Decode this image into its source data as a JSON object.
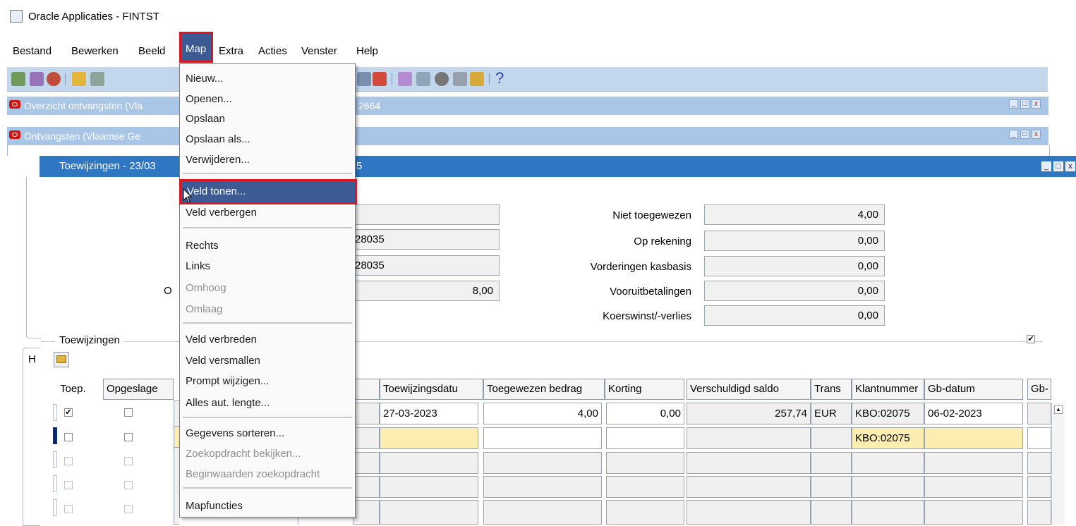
{
  "window": {
    "title": "Oracle Applicaties - FINTST"
  },
  "menubar": {
    "items": [
      {
        "label": "Bestand"
      },
      {
        "label": "Bewerken"
      },
      {
        "label": "Beeld"
      },
      {
        "label": "Map"
      },
      {
        "label": "Extra"
      },
      {
        "label": "Acties"
      },
      {
        "label": "Venster"
      },
      {
        "label": "Help"
      }
    ]
  },
  "toolbar": {
    "help_glyph": "?"
  },
  "windows": {
    "overzicht_title": "Overzicht ontvangsten (Vla",
    "overzicht_title_tail": "2664",
    "ontvangsten_title": "Ontvangsten (Vlaamse Ge",
    "toewijzingen_title": "Toewijzingen - 23/03",
    "toewijzingen_title_tail": "5"
  },
  "summary": {
    "left_values": [
      "28035",
      "28035",
      "8,00"
    ],
    "left_partial_label": "O",
    "right_labels": [
      "Niet toegewezen",
      "Op rekening",
      "Vorderingen kasbasis",
      "Vooruitbetalingen",
      "Koerswinst/-verlies"
    ],
    "right_values": [
      "4,00",
      "0,00",
      "0,00",
      "0,00",
      "0,00"
    ]
  },
  "section": {
    "label": "Toewijzingen",
    "tab_partial": "H",
    "checkbox_checked": "✔"
  },
  "table": {
    "headers": {
      "toep": "Toep.",
      "opgeslagen": "Opgeslage",
      "toewijzingsdatum": "Toewijzingsdatu",
      "toegewezen_bedrag": "Toegewezen bedrag",
      "korting": "Korting",
      "verschuldigd_saldo": "Verschuldigd saldo",
      "trans": "Trans",
      "klantnummer": "Klantnummer",
      "gb_datum": "Gb-datum",
      "gb2": "Gb-"
    },
    "row1": {
      "toep": "✔",
      "toewijzingsdatum": "27-03-2023",
      "toegewezen_bedrag": "4,00",
      "korting": "0,00",
      "verschuldigd_saldo": "257,74",
      "trans": "EUR",
      "klantnummer": "KBO:02075",
      "gb_datum": "06-02-2023"
    },
    "row2": {
      "klantnummer": "KBO:02075"
    }
  },
  "dropdown": {
    "items": [
      {
        "label": "Nieuw...",
        "enabled": true
      },
      {
        "label": "Openen...",
        "enabled": true
      },
      {
        "label": "Opslaan",
        "enabled": true
      },
      {
        "label": "Opslaan als...",
        "enabled": true
      },
      {
        "label": "Verwijderen...",
        "enabled": true
      },
      {
        "label": "Veld tonen...",
        "enabled": true,
        "highlighted": true
      },
      {
        "label": "Veld verbergen",
        "enabled": true
      },
      {
        "label": "Rechts",
        "enabled": true
      },
      {
        "label": "Links",
        "enabled": true
      },
      {
        "label": "Omhoog",
        "enabled": false
      },
      {
        "label": "Omlaag",
        "enabled": false
      },
      {
        "label": "Veld verbreden",
        "enabled": true
      },
      {
        "label": "Veld versmallen",
        "enabled": true
      },
      {
        "label": "Prompt wijzigen...",
        "enabled": true
      },
      {
        "label": "Alles aut. lengte...",
        "enabled": true
      },
      {
        "label": "Gegevens sorteren...",
        "enabled": true
      },
      {
        "label": "Zoekopdracht bekijken...",
        "enabled": false
      },
      {
        "label": "Beginwaarden zoekopdracht",
        "enabled": false
      },
      {
        "label": "Mapfuncties",
        "enabled": true
      }
    ]
  },
  "colors": {
    "highlight_border": "#e0161f",
    "menu_selection": "#3c5a93",
    "active_title": "#2f77c3",
    "inactive_title": "#a9c6e6"
  }
}
